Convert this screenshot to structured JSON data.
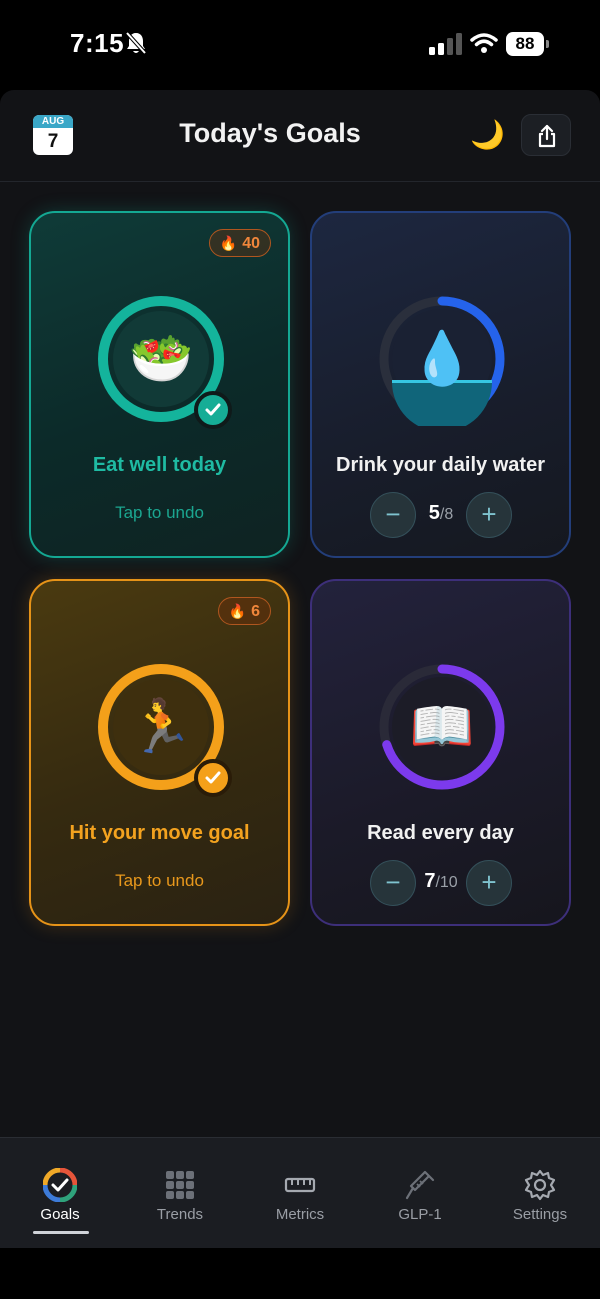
{
  "status": {
    "time": "7:15",
    "battery": "88"
  },
  "header": {
    "calendar_month": "AUG",
    "calendar_day": "7",
    "title": "Today's Goals",
    "theme_icon": "moon-icon",
    "share_icon": "share-icon"
  },
  "goals": [
    {
      "title": "Eat well today",
      "streak": "40",
      "emoji": "🥗",
      "undo_label": "Tap to undo",
      "completed": true,
      "color": "#14a893"
    },
    {
      "title": "Drink your daily water",
      "emoji": "💧",
      "count": "5",
      "total": "/8",
      "progress": 0.625,
      "color": "#2563eb"
    },
    {
      "title": "Hit your move goal",
      "streak": "6",
      "emoji": "🏃",
      "undo_label": "Tap to undo",
      "completed": true,
      "color": "#f4a01a"
    },
    {
      "title": "Read every day",
      "emoji": "📖",
      "count": "7",
      "total": "/10",
      "progress": 0.7,
      "color": "#7c3aed"
    }
  ],
  "tabs": [
    {
      "label": "Goals",
      "icon": "goals-icon",
      "active": true
    },
    {
      "label": "Trends",
      "icon": "grid-icon"
    },
    {
      "label": "Metrics",
      "icon": "ruler-icon"
    },
    {
      "label": "GLP-1",
      "icon": "syringe-icon"
    },
    {
      "label": "Settings",
      "icon": "gear-icon"
    }
  ]
}
